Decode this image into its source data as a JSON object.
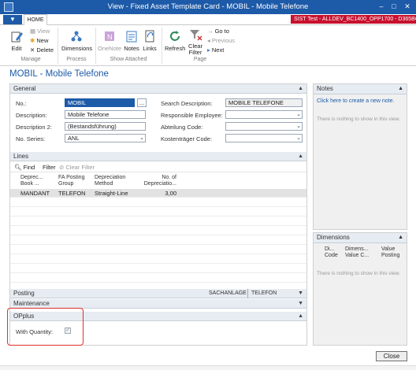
{
  "window": {
    "title": "View - Fixed Asset Template Card - MOBIL - Mobile Telefone",
    "server": "SIST Test - ALLDEV_BC1400_OPP1700 - D365BC1..."
  },
  "ribbon": {
    "file_tab": "▼",
    "home_tab": "HOME",
    "view": "View",
    "new": "New",
    "edit": "Edit",
    "delete": "Delete",
    "manage": "Manage",
    "dimensions": "Dimensions",
    "process": "Process",
    "onenote": "OneNote",
    "notes": "Notes",
    "links": "Links",
    "show_attached": "Show Attached",
    "refresh": "Refresh",
    "clear_filter": "Clear Filter",
    "goto": "Go to",
    "previous": "Previous",
    "next": "Next",
    "page": "Page"
  },
  "heading": "MOBIL - Mobile Telefone",
  "general": {
    "title": "General",
    "no_label": "No.:",
    "no_value": "MOBIL",
    "desc_label": "Description:",
    "desc_value": "Mobile Telefone",
    "desc2_label": "Description 2:",
    "desc2_value": "(Bestandsführung)",
    "series_label": "No. Series:",
    "series_value": "ANL",
    "search_label": "Search Description:",
    "search_value": "MOBILE TELEFONE",
    "resp_label": "Responsible Employee:",
    "resp_value": "",
    "abt_label": "Abteilung Code:",
    "abt_value": "",
    "kst_label": "Kostenträger Code:",
    "kst_value": ""
  },
  "lines": {
    "title": "Lines",
    "find": "Find",
    "filter": "Filter",
    "clear_filter": "Clear Filter",
    "columns": [
      "Deprec... Book ...",
      "FA Posting Group",
      "Depreciation Method",
      "No. of Depreciatio..."
    ],
    "rows": [
      [
        "MANDANT",
        "TELEFON",
        "Straight-Line",
        "3,00"
      ]
    ]
  },
  "posting": {
    "title": "Posting",
    "summary1": "SACHANLAGE",
    "summary2": "TELEFON"
  },
  "maintenance": {
    "title": "Maintenance"
  },
  "opplus": {
    "title": "OPplus",
    "with_quantity": "With Quantity:"
  },
  "notes": {
    "title": "Notes",
    "link": "Click here to create a new note.",
    "empty": "There is nothing to show in this view."
  },
  "dimensions": {
    "title": "Dimensions",
    "columns": [
      "Di... Code",
      "Dimens... Value C...",
      "Value Posting"
    ],
    "empty": "There is nothing to show in this view."
  },
  "close_label": "Close",
  "colors": {
    "brand": "#1d5aa8",
    "server_badge": "#c8102e",
    "highlight": "#e0302a"
  }
}
